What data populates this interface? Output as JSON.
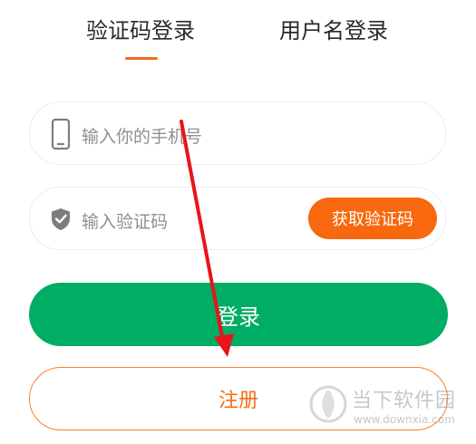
{
  "tabs": [
    {
      "label": "验证码登录",
      "active": true
    },
    {
      "label": "用户名登录",
      "active": false
    }
  ],
  "phone": {
    "placeholder": "输入你的手机号",
    "icon": "phone-icon"
  },
  "code": {
    "placeholder": "输入验证码",
    "icon": "shield-check-icon",
    "get_code_label": "获取验证码"
  },
  "login_label": "登录",
  "register_label": "注册",
  "watermark": {
    "name": "当下软件园",
    "url": "www.downxia.com"
  },
  "colors": {
    "accent_orange": "#f7680f",
    "login_green": "#00ad64",
    "annotation_red": "#e8141b"
  }
}
